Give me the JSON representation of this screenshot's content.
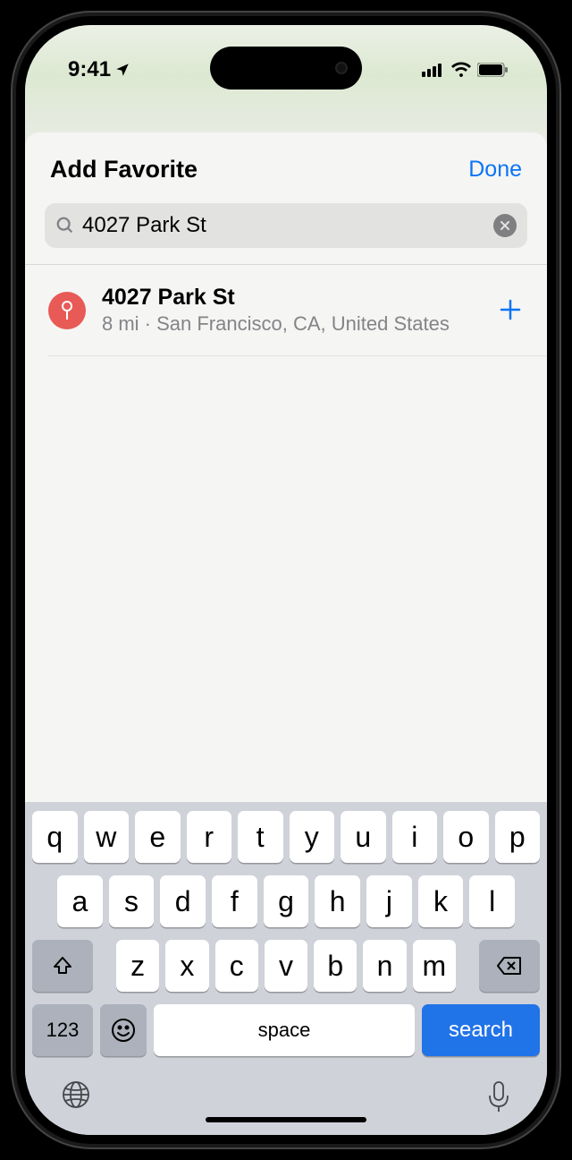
{
  "status": {
    "time": "9:41"
  },
  "sheet": {
    "title": "Add Favorite",
    "done": "Done"
  },
  "search": {
    "value": "4027 Park St"
  },
  "result": {
    "title": "4027 Park St",
    "subtitle": "8 mi · San Francisco, CA, United States"
  },
  "keyboard": {
    "row1": [
      "q",
      "w",
      "e",
      "r",
      "t",
      "y",
      "u",
      "i",
      "o",
      "p"
    ],
    "row2": [
      "a",
      "s",
      "d",
      "f",
      "g",
      "h",
      "j",
      "k",
      "l"
    ],
    "row3": [
      "z",
      "x",
      "c",
      "v",
      "b",
      "n",
      "m"
    ],
    "numeric": "123",
    "space": "space",
    "search": "search"
  }
}
